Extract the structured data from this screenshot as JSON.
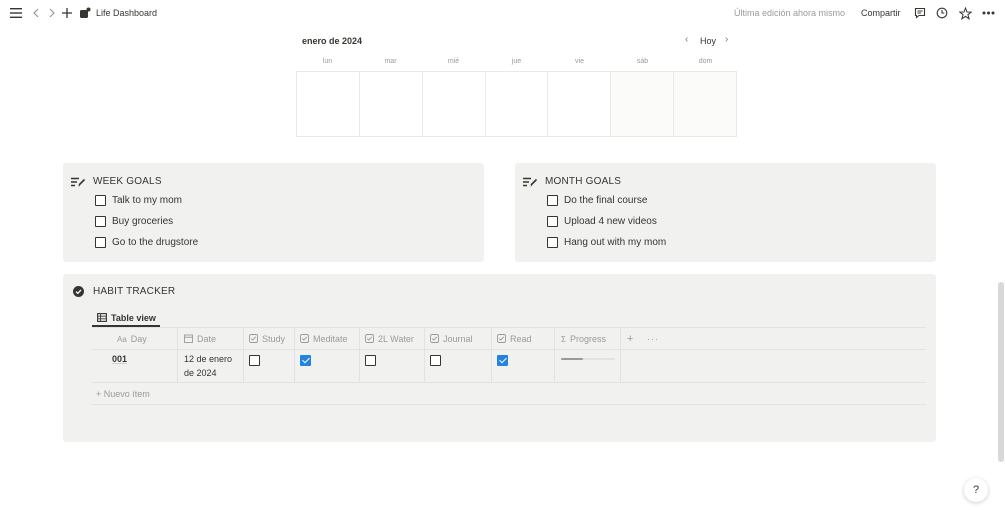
{
  "topbar": {
    "title": "Life Dashboard",
    "last_edited": "Última edición ahora mismo",
    "share_label": "Compartir",
    "icons": [
      "menu-icon",
      "back-icon",
      "forward-icon",
      "add-icon",
      "page-icon",
      "comment-icon",
      "history-icon",
      "star-icon",
      "more-icon"
    ]
  },
  "calendar": {
    "month": "enero de 2024",
    "today_label": "Hoy",
    "weekdays": [
      "lun",
      "mar",
      "mié",
      "jue",
      "vie",
      "sáb",
      "dom"
    ]
  },
  "week_goals": {
    "title": "WEEK GOALS",
    "items": [
      "Talk to my mom",
      "Buy groceries",
      "Go to the drugstore"
    ]
  },
  "month_goals": {
    "title": "MONTH GOALS",
    "items": [
      "Do the final course",
      "Upload 4 new videos",
      "Hang out with my mom"
    ]
  },
  "habit_tracker": {
    "title": "HABIT TRACKER",
    "view_label": "Table view",
    "columns": {
      "day": {
        "icon": "Aa",
        "label": "Day"
      },
      "date": {
        "label": "Date"
      },
      "study": {
        "label": "Study"
      },
      "meditate": {
        "label": "Meditate"
      },
      "water": {
        "label": "2L Water"
      },
      "journal": {
        "label": "Journal"
      },
      "read": {
        "label": "Read"
      },
      "progress": {
        "icon": "Σ",
        "label": "Progress"
      }
    },
    "rows": [
      {
        "day": "001",
        "date_line1": "12 de enero",
        "date_line2": "de 2024",
        "study": false,
        "meditate": true,
        "water": false,
        "journal": false,
        "read": true,
        "progress": 0.4
      }
    ],
    "new_item_label": "+ Nuevo ítem",
    "add_column": "+",
    "more": "···"
  },
  "colors": {
    "accent": "#2383e2",
    "callout_bg": "#f1f1ef",
    "text": "#37352f",
    "muted": "#9b9a97"
  },
  "help_label": "?"
}
